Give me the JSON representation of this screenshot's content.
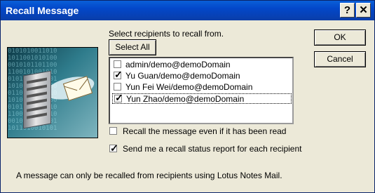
{
  "window": {
    "title": "Recall Message",
    "help_glyph": "?",
    "close_glyph": "✕"
  },
  "main": {
    "select_label": "Select recipients to recall from.",
    "select_all": "Select All",
    "recipients": [
      {
        "label": "admin/demo@demoDomain",
        "checked": false
      },
      {
        "label": "Yu Guan/demo@demoDomain",
        "checked": true
      },
      {
        "label": "Yun Fei Wei/demo@demoDomain",
        "checked": false
      },
      {
        "label": "Yun Zhao/demo@demoDomain",
        "checked": true
      }
    ],
    "options": [
      {
        "label": "Recall the message even if it has been read",
        "checked": false
      },
      {
        "label": "Send me a recall status report for each recipient",
        "checked": true
      }
    ],
    "note": "A message can only be recalled from recipients using Lotus Notes Mail."
  },
  "buttons": {
    "ok": "OK",
    "cancel": "Cancel"
  },
  "art": {
    "icons": [
      "server-icon",
      "mail-envelope-icon"
    ]
  }
}
